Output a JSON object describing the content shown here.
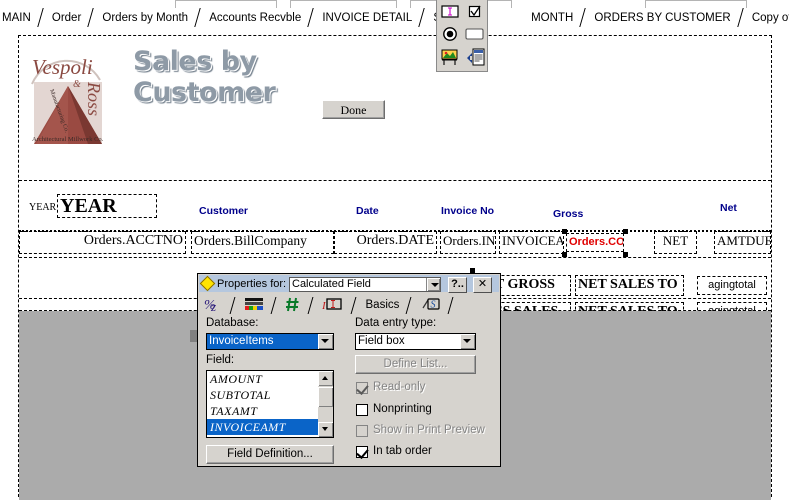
{
  "tabstrip": {
    "tabs": [
      {
        "label": "MAIN"
      },
      {
        "label": "Order"
      },
      {
        "label": "Orders by Month"
      },
      {
        "label": "Accounts Recvble"
      },
      {
        "label": "INVOICE DETAIL"
      },
      {
        "label": "SUM ("
      },
      {
        "label": "MONTH"
      },
      {
        "label": "ORDERS BY CUSTOMER"
      },
      {
        "label": "Copy of Invoice"
      }
    ]
  },
  "float_toolbar": {
    "buttons": [
      {
        "name": "text-field-tool",
        "icon": "text-cursor-box-icon"
      },
      {
        "name": "checkbox-tool",
        "icon": "checkbox-icon"
      },
      {
        "name": "radio-button-tool",
        "icon": "radio-button-icon"
      },
      {
        "name": "button-tool",
        "icon": "rounded-button-icon"
      },
      {
        "name": "image-tool",
        "icon": "picture-easel-icon"
      },
      {
        "name": "subform-tool",
        "icon": "subform-paste-icon"
      }
    ]
  },
  "report": {
    "logo": {
      "brand_top": "Vespoli",
      "brand_amp": "&",
      "brand_right": "Ross",
      "tagline_left": "Manufacturing Co.",
      "tagline_bottom": "Architectural Millwork"
    },
    "title": "Sales by\nCustomer",
    "done_button": "Done",
    "column_headers": [
      {
        "label": "Customer"
      },
      {
        "label": "Date"
      },
      {
        "label": "Invoice No"
      },
      {
        "label": "Gross"
      },
      {
        "label": "Net"
      }
    ],
    "group_band": {
      "year_label": "YEAR",
      "year_field": "YEAR"
    },
    "detail_fields": [
      {
        "label": "Orders.ACCTNO"
      },
      {
        "label": "Orders.BillCompany"
      },
      {
        "label": "Orders.DATE"
      },
      {
        "label": "Orders.IN"
      },
      {
        "label": "INVOICEA"
      },
      {
        "label": "Orders.CO",
        "color": "#e00000"
      },
      {
        "label": "NET"
      },
      {
        "label": "AMTDUE"
      }
    ],
    "summary_rows": [
      {
        "cells": [
          "OT GROSS",
          "NET SALES TO",
          "agingtotal"
        ]
      },
      {
        "cells": [
          "OSS SALES",
          "NET SALES TO",
          "agingtotal"
        ]
      }
    ]
  },
  "properties_dialog": {
    "title": "Properties for:",
    "object_combo_value": "Calculated Field",
    "help_button": "?..",
    "close_button": "✕",
    "tabs": [
      {
        "name": "format-text-tab",
        "icon": "italic-z-icon"
      },
      {
        "name": "color-tab",
        "icon": "color-palette-icon"
      },
      {
        "name": "number-tab",
        "icon": "hash-icon"
      },
      {
        "name": "field-tab",
        "icon": "text-field-icon"
      },
      {
        "name": "basics-tab",
        "label": "Basics"
      },
      {
        "name": "script-tab",
        "icon": "script-s-icon"
      }
    ],
    "database_label": "Database:",
    "database_value": "InvoiceItems",
    "field_label": "Field:",
    "field_list": [
      "AMOUNT",
      "SUBTOTAL",
      "TAXAMT",
      "INVOICEAMT"
    ],
    "field_selected": "INVOICEAMT",
    "field_definition_button": "Field Definition...",
    "data_entry_label": "Data entry type:",
    "data_entry_value": "Field box",
    "define_list_button": "Define List...",
    "checkboxes": [
      {
        "label": "Read-only",
        "checked": true,
        "disabled": true
      },
      {
        "label": "Nonprinting",
        "checked": false,
        "disabled": false
      },
      {
        "label": "Show in Print Preview",
        "checked": false,
        "disabled": true
      },
      {
        "label": "In tab order",
        "checked": true,
        "disabled": false
      }
    ]
  },
  "colors": {
    "gray_area": "#ababab",
    "titlebar": "#b5c7de",
    "dialog_face": "#d6d3ce",
    "selection_blue": "#0a64c8",
    "header_label_blue": "#00008b",
    "selected_field_red": "#e00000",
    "logo_brown": "#8b4a42"
  }
}
